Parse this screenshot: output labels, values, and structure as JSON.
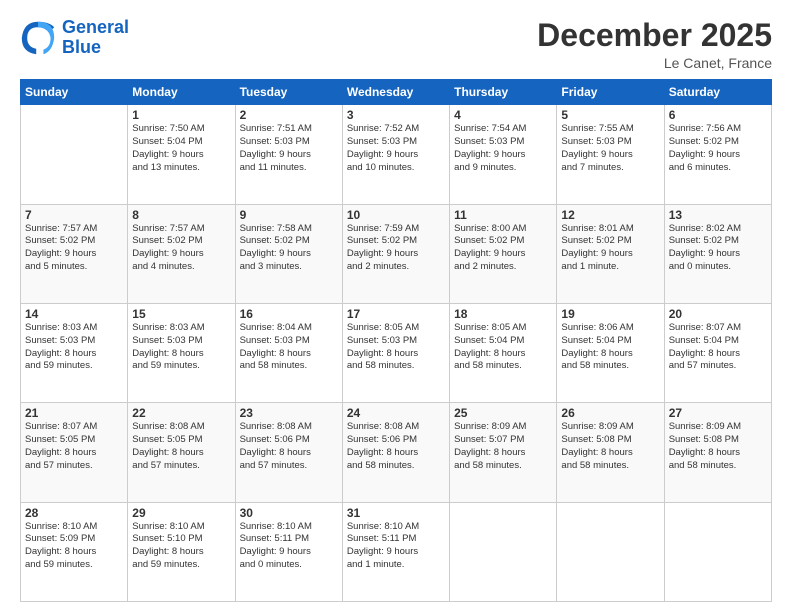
{
  "logo": {
    "line1": "General",
    "line2": "Blue"
  },
  "title": "December 2025",
  "location": "Le Canet, France",
  "days_of_week": [
    "Sunday",
    "Monday",
    "Tuesday",
    "Wednesday",
    "Thursday",
    "Friday",
    "Saturday"
  ],
  "weeks": [
    [
      {
        "day": "",
        "info": ""
      },
      {
        "day": "1",
        "info": "Sunrise: 7:50 AM\nSunset: 5:04 PM\nDaylight: 9 hours\nand 13 minutes."
      },
      {
        "day": "2",
        "info": "Sunrise: 7:51 AM\nSunset: 5:03 PM\nDaylight: 9 hours\nand 11 minutes."
      },
      {
        "day": "3",
        "info": "Sunrise: 7:52 AM\nSunset: 5:03 PM\nDaylight: 9 hours\nand 10 minutes."
      },
      {
        "day": "4",
        "info": "Sunrise: 7:54 AM\nSunset: 5:03 PM\nDaylight: 9 hours\nand 9 minutes."
      },
      {
        "day": "5",
        "info": "Sunrise: 7:55 AM\nSunset: 5:03 PM\nDaylight: 9 hours\nand 7 minutes."
      },
      {
        "day": "6",
        "info": "Sunrise: 7:56 AM\nSunset: 5:02 PM\nDaylight: 9 hours\nand 6 minutes."
      }
    ],
    [
      {
        "day": "7",
        "info": "Sunrise: 7:57 AM\nSunset: 5:02 PM\nDaylight: 9 hours\nand 5 minutes."
      },
      {
        "day": "8",
        "info": "Sunrise: 7:57 AM\nSunset: 5:02 PM\nDaylight: 9 hours\nand 4 minutes."
      },
      {
        "day": "9",
        "info": "Sunrise: 7:58 AM\nSunset: 5:02 PM\nDaylight: 9 hours\nand 3 minutes."
      },
      {
        "day": "10",
        "info": "Sunrise: 7:59 AM\nSunset: 5:02 PM\nDaylight: 9 hours\nand 2 minutes."
      },
      {
        "day": "11",
        "info": "Sunrise: 8:00 AM\nSunset: 5:02 PM\nDaylight: 9 hours\nand 2 minutes."
      },
      {
        "day": "12",
        "info": "Sunrise: 8:01 AM\nSunset: 5:02 PM\nDaylight: 9 hours\nand 1 minute."
      },
      {
        "day": "13",
        "info": "Sunrise: 8:02 AM\nSunset: 5:02 PM\nDaylight: 9 hours\nand 0 minutes."
      }
    ],
    [
      {
        "day": "14",
        "info": "Sunrise: 8:03 AM\nSunset: 5:03 PM\nDaylight: 8 hours\nand 59 minutes."
      },
      {
        "day": "15",
        "info": "Sunrise: 8:03 AM\nSunset: 5:03 PM\nDaylight: 8 hours\nand 59 minutes."
      },
      {
        "day": "16",
        "info": "Sunrise: 8:04 AM\nSunset: 5:03 PM\nDaylight: 8 hours\nand 58 minutes."
      },
      {
        "day": "17",
        "info": "Sunrise: 8:05 AM\nSunset: 5:03 PM\nDaylight: 8 hours\nand 58 minutes."
      },
      {
        "day": "18",
        "info": "Sunrise: 8:05 AM\nSunset: 5:04 PM\nDaylight: 8 hours\nand 58 minutes."
      },
      {
        "day": "19",
        "info": "Sunrise: 8:06 AM\nSunset: 5:04 PM\nDaylight: 8 hours\nand 58 minutes."
      },
      {
        "day": "20",
        "info": "Sunrise: 8:07 AM\nSunset: 5:04 PM\nDaylight: 8 hours\nand 57 minutes."
      }
    ],
    [
      {
        "day": "21",
        "info": "Sunrise: 8:07 AM\nSunset: 5:05 PM\nDaylight: 8 hours\nand 57 minutes."
      },
      {
        "day": "22",
        "info": "Sunrise: 8:08 AM\nSunset: 5:05 PM\nDaylight: 8 hours\nand 57 minutes."
      },
      {
        "day": "23",
        "info": "Sunrise: 8:08 AM\nSunset: 5:06 PM\nDaylight: 8 hours\nand 57 minutes."
      },
      {
        "day": "24",
        "info": "Sunrise: 8:08 AM\nSunset: 5:06 PM\nDaylight: 8 hours\nand 58 minutes."
      },
      {
        "day": "25",
        "info": "Sunrise: 8:09 AM\nSunset: 5:07 PM\nDaylight: 8 hours\nand 58 minutes."
      },
      {
        "day": "26",
        "info": "Sunrise: 8:09 AM\nSunset: 5:08 PM\nDaylight: 8 hours\nand 58 minutes."
      },
      {
        "day": "27",
        "info": "Sunrise: 8:09 AM\nSunset: 5:08 PM\nDaylight: 8 hours\nand 58 minutes."
      }
    ],
    [
      {
        "day": "28",
        "info": "Sunrise: 8:10 AM\nSunset: 5:09 PM\nDaylight: 8 hours\nand 59 minutes."
      },
      {
        "day": "29",
        "info": "Sunrise: 8:10 AM\nSunset: 5:10 PM\nDaylight: 8 hours\nand 59 minutes."
      },
      {
        "day": "30",
        "info": "Sunrise: 8:10 AM\nSunset: 5:11 PM\nDaylight: 9 hours\nand 0 minutes."
      },
      {
        "day": "31",
        "info": "Sunrise: 8:10 AM\nSunset: 5:11 PM\nDaylight: 9 hours\nand 1 minute."
      },
      {
        "day": "",
        "info": ""
      },
      {
        "day": "",
        "info": ""
      },
      {
        "day": "",
        "info": ""
      }
    ]
  ]
}
